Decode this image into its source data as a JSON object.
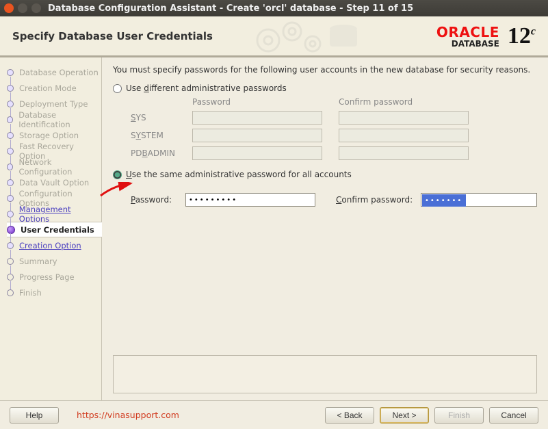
{
  "window": {
    "title": "Database Configuration Assistant - Create 'orcl' database - Step 11 of 15"
  },
  "header": {
    "page_title": "Specify Database User Credentials",
    "brand_top": "ORACLE",
    "brand_sub": "DATABASE",
    "brand_ver_num": "12",
    "brand_ver_suf": "c"
  },
  "sidebar": {
    "steps": [
      {
        "label": "Database Operation",
        "state": "done"
      },
      {
        "label": "Creation Mode",
        "state": "done"
      },
      {
        "label": "Deployment Type",
        "state": "done"
      },
      {
        "label": "Database Identification",
        "state": "done"
      },
      {
        "label": "Storage Option",
        "state": "done"
      },
      {
        "label": "Fast Recovery Option",
        "state": "done"
      },
      {
        "label": "Network Configuration",
        "state": "done"
      },
      {
        "label": "Data Vault Option",
        "state": "done"
      },
      {
        "label": "Configuration Options",
        "state": "done"
      },
      {
        "label": "Management Options",
        "state": "link"
      },
      {
        "label": "User Credentials",
        "state": "active"
      },
      {
        "label": "Creation Option",
        "state": "link"
      },
      {
        "label": "Summary",
        "state": "todo"
      },
      {
        "label": "Progress Page",
        "state": "todo"
      },
      {
        "label": "Finish",
        "state": "todo"
      }
    ]
  },
  "main": {
    "instruction": "You must specify passwords for the following user accounts in the new database for security reasons.",
    "radio_diff": "Use different administrative passwords",
    "col_password": "Password",
    "col_confirm": "Confirm password",
    "acct_sys": "SYS",
    "acct_system": "SYSTEM",
    "acct_pdbadmin": "PDBADMIN",
    "radio_same": "Use the same administrative password for all accounts",
    "lbl_password": "Password:",
    "lbl_confirm": "Confirm password:",
    "val_password": "•••••••••",
    "val_confirm": "••••••••"
  },
  "footer": {
    "help": "Help",
    "support_url": "https://vinasupport.com",
    "back": "< Back",
    "next": "Next >",
    "finish": "Finish",
    "cancel": "Cancel"
  }
}
